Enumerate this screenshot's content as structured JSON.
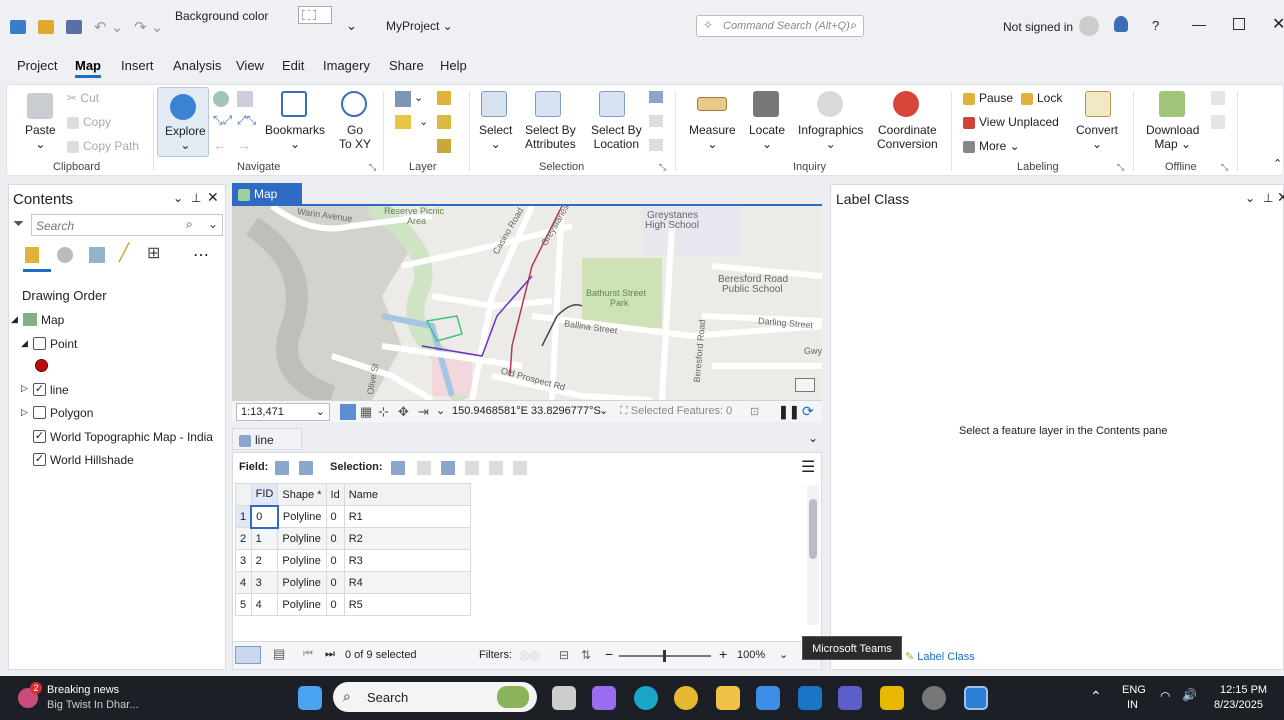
{
  "titlebar": {
    "background_color_label": "Background color",
    "project_name": "MyProject",
    "command_search_placeholder": "Command Search (Alt+Q)",
    "signin_status": "Not signed in",
    "help_label": "?"
  },
  "menu": [
    "Project",
    "Map",
    "Insert",
    "Analysis",
    "View",
    "Edit",
    "Imagery",
    "Share",
    "Help"
  ],
  "ribbon": {
    "clipboard": {
      "paste": "Paste",
      "cut": "Cut",
      "copy": "Copy",
      "copy_path": "Copy Path",
      "group": "Clipboard"
    },
    "navigate": {
      "explore": "Explore",
      "bookmarks": "Bookmarks",
      "goto_xy_1": "Go",
      "goto_xy_2": "To XY",
      "group": "Navigate"
    },
    "layer": {
      "group": "Layer"
    },
    "selection": {
      "select": "Select",
      "by_attr_1": "Select By",
      "by_attr_2": "Attributes",
      "by_loc_1": "Select By",
      "by_loc_2": "Location",
      "group": "Selection"
    },
    "inquiry": {
      "measure": "Measure",
      "locate": "Locate",
      "infographics": "Infographics",
      "coord_1": "Coordinate",
      "coord_2": "Conversion",
      "group": "Inquiry"
    },
    "labeling": {
      "pause": "Pause",
      "lock": "Lock",
      "view_unplaced": "View Unplaced",
      "more": "More",
      "convert": "Convert",
      "group": "Labeling"
    },
    "offline": {
      "download_1": "Download",
      "download_2": "Map",
      "group": "Offline"
    }
  },
  "contents": {
    "title": "Contents",
    "search_placeholder": "Search",
    "drawing_order": "Drawing Order",
    "layers": [
      {
        "name": "Map",
        "checked": null
      },
      {
        "name": "Point",
        "checked": false
      },
      {
        "name": "line",
        "checked": true
      },
      {
        "name": "Polygon",
        "checked": false
      },
      {
        "name": "World Topographic Map - India",
        "checked": true
      },
      {
        "name": "World Hillshade",
        "checked": true
      }
    ]
  },
  "map_tab": {
    "label": "Map"
  },
  "map_labels": {
    "warin": "Warin Avenue",
    "reserve": "Reserve Picnic",
    "area": "Area",
    "casino": "Casino Road",
    "greystanes_rd": "Greystanes",
    "school1": "Greystanes",
    "school2": "High School",
    "bathurst1": "Bathurst Street",
    "bathurst2": "Park",
    "ballina": "Ballina Street",
    "beresford_rd": "Beresford Road",
    "beresford1": "Beresford Road",
    "beresford2": "Public School",
    "darling": "Darling Street",
    "oldprospect": "Old Prospect Rd",
    "gwy": "Gwy",
    "oliv": "Olive St"
  },
  "map_status": {
    "scale": "1:13,471",
    "coords": "150.9468581°E 33.8296777°S",
    "selected_features": "Selected Features: 0"
  },
  "attr_table": {
    "tab": "line",
    "field_label": "Field:",
    "selection_label": "Selection:",
    "columns": [
      "FID",
      "Shape *",
      "Id",
      "Name"
    ],
    "rows": [
      {
        "n": "1",
        "fid": "0",
        "shape": "Polyline",
        "id": "0",
        "name": "R1"
      },
      {
        "n": "2",
        "fid": "1",
        "shape": "Polyline",
        "id": "0",
        "name": "R2"
      },
      {
        "n": "3",
        "fid": "2",
        "shape": "Polyline",
        "id": "0",
        "name": "R3"
      },
      {
        "n": "4",
        "fid": "3",
        "shape": "Polyline",
        "id": "0",
        "name": "R4"
      },
      {
        "n": "5",
        "fid": "4",
        "shape": "Polyline",
        "id": "0",
        "name": "R5"
      }
    ],
    "selected_text": "0 of 9 selected",
    "filters_label": "Filters:",
    "zoom": "100%"
  },
  "label_class": {
    "title": "Label Class",
    "message": "Select a feature layer in the Contents pane",
    "tab": "Label Class"
  },
  "tooltip": "Microsoft Teams",
  "taskbar": {
    "news_badge": "2",
    "news_title": "Breaking news",
    "news_sub": "Big Twist In Dhar...",
    "search": "Search",
    "lang1": "ENG",
    "lang2": "IN",
    "time": "12:15 PM",
    "date": "8/23/2025"
  }
}
